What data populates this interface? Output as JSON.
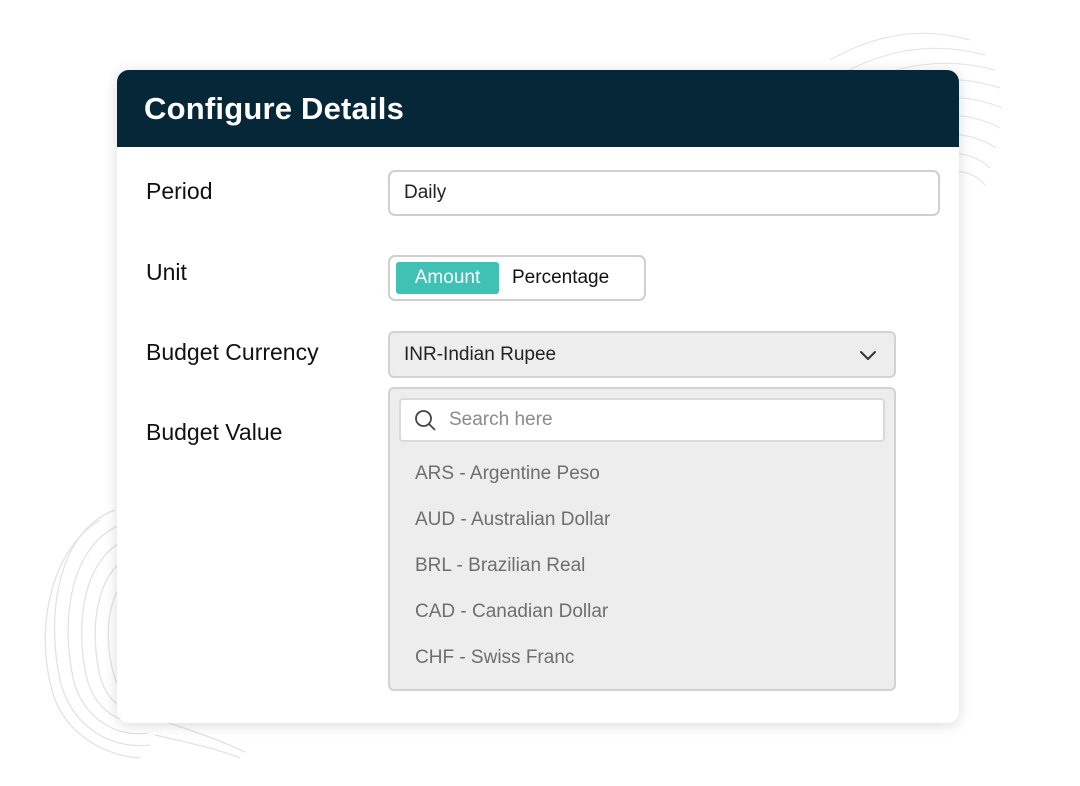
{
  "dialog": {
    "title": "Configure Details"
  },
  "fields": {
    "period": {
      "label": "Period",
      "value": "Daily"
    },
    "unit": {
      "label": "Unit",
      "options": [
        "Amount",
        "Percentage"
      ],
      "selected": "Amount"
    },
    "budget_currency": {
      "label": "Budget Currency",
      "value": "INR-Indian Rupee"
    },
    "budget_value": {
      "label": "Budget Value"
    }
  },
  "currency_dropdown": {
    "search_placeholder": "Search here",
    "options": [
      "ARS - Argentine Peso",
      "AUD - Australian Dollar",
      "BRL - Brazilian Real",
      "CAD - Canadian Dollar",
      "CHF - Swiss Franc"
    ]
  },
  "colors": {
    "header_bg": "#052737",
    "accent": "#3fc1b4",
    "dropdown_bg": "#ededed"
  },
  "icons": {
    "search": "search-icon",
    "select_chevron": "chevron-down-icon"
  }
}
